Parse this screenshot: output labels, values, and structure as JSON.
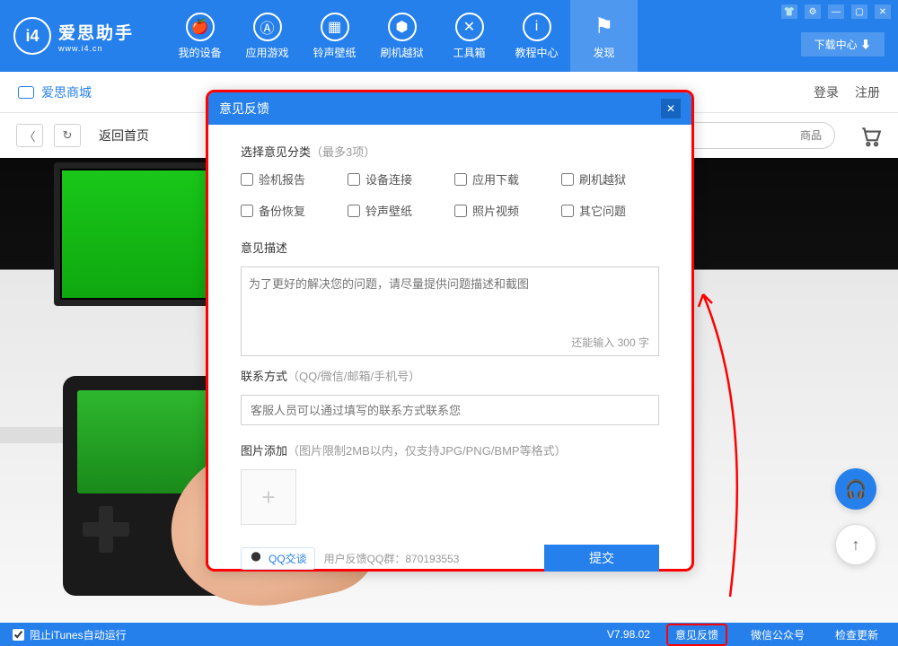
{
  "app": {
    "name": "爱思助手",
    "url": "www.i4.cn",
    "logo_letter": "i4"
  },
  "nav": [
    {
      "label": "我的设备"
    },
    {
      "label": "应用游戏"
    },
    {
      "label": "铃声壁纸"
    },
    {
      "label": "刷机越狱"
    },
    {
      "label": "工具箱"
    },
    {
      "label": "教程中心"
    },
    {
      "label": "发现"
    }
  ],
  "download_center": "下载中心 ⬇",
  "subbar": {
    "store": "爱思商城",
    "login": "登录",
    "register": "注册"
  },
  "toolbar": {
    "back_home": "返回首页",
    "search_placeholder": "商品"
  },
  "modal": {
    "title": "意见反馈",
    "category_label": "选择意见分类",
    "category_hint": "（最多3项）",
    "categories": [
      "验机报告",
      "设备连接",
      "应用下载",
      "刷机越狱",
      "备份恢复",
      "铃声壁纸",
      "照片视频",
      "其它问题"
    ],
    "desc_label": "意见描述",
    "desc_placeholder": "为了更好的解决您的问题，请尽量提供问题描述和截图",
    "char_count_prefix": "还能输入 ",
    "char_count_num": "300",
    "char_count_suffix": " 字",
    "contact_label": "联系方式",
    "contact_hint": "（QQ/微信/邮箱/手机号）",
    "contact_placeholder": "客服人员可以通过填写的联系方式联系您",
    "upload_label": "图片添加",
    "upload_hint": "（图片限制2MB以内，仅支持JPG/PNG/BMP等格式）",
    "qq_chat": "QQ交谈",
    "qq_group_label": "用户反馈QQ群：",
    "qq_group_num": "870193553",
    "submit": "提交"
  },
  "footer": {
    "block_itunes": "阻止iTunes自动运行",
    "version": "V7.98.02",
    "feedback": "意见反馈",
    "wechat": "微信公众号",
    "check_update": "检查更新"
  }
}
